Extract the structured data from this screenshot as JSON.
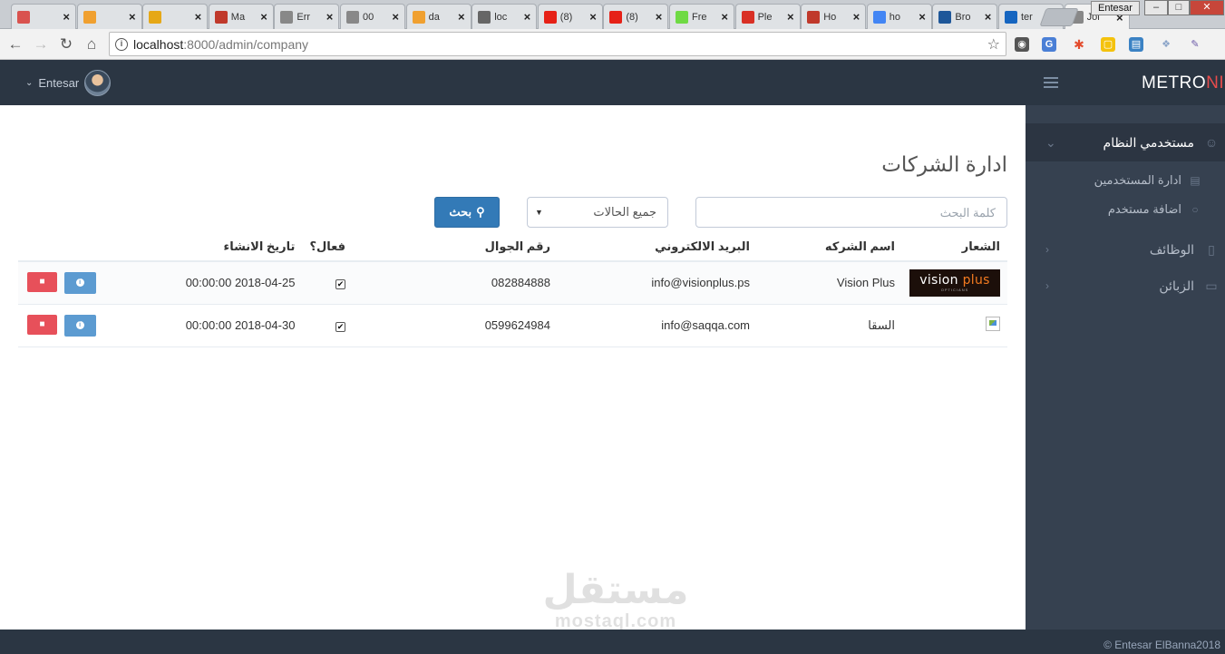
{
  "browser": {
    "tabs": [
      {
        "title": "",
        "favicon": "download-icon",
        "color": "#d9534f"
      },
      {
        "title": "",
        "favicon": "phpmyadmin-icon",
        "color": "#f0a030"
      },
      {
        "title": "",
        "favicon": "bulb-icon",
        "color": "#e6a817"
      },
      {
        "title": "Ma",
        "favicon": "redirect-icon",
        "color": "#c0392b"
      },
      {
        "title": "Err",
        "favicon": "page-icon",
        "color": "#888888"
      },
      {
        "title": "00",
        "favicon": "page-icon",
        "color": "#888888"
      },
      {
        "title": "da",
        "favicon": "phpmyadmin-icon",
        "color": "#f0a030"
      },
      {
        "title": "loc",
        "favicon": "bootstrap-icon",
        "color": "#666666"
      },
      {
        "title": "(8)",
        "favicon": "youtube-icon",
        "color": "#e62117"
      },
      {
        "title": "(8)",
        "favicon": "youtube-icon",
        "color": "#e62117"
      },
      {
        "title": "Fre",
        "favicon": "upwork-icon",
        "color": "#6fda44"
      },
      {
        "title": "Ple",
        "favicon": "gmail-icon",
        "color": "#d93025"
      },
      {
        "title": "Ho",
        "favicon": "hosting-icon",
        "color": "#c0392b"
      },
      {
        "title": "ho",
        "favicon": "google-icon",
        "color": "#4285f4"
      },
      {
        "title": "Bro",
        "favicon": "box-icon",
        "color": "#1e5799"
      },
      {
        "title": "ter",
        "favicon": "tm-icon",
        "color": "#1565c0"
      },
      {
        "title": "Jol",
        "favicon": "page-icon",
        "color": "#888888"
      }
    ],
    "profile_name": "Entesar",
    "url_host": "localhost",
    "url_rest": ":8000/admin/company"
  },
  "header": {
    "logo_main": "METRO",
    "logo_accent": "NIC",
    "user_name": "Entesar"
  },
  "sidebar": {
    "section_label": "مستخدمي النظام",
    "sub_items": [
      "ادارة المستخدمين",
      "اضافة مستخدم"
    ],
    "items": [
      "الوظائف",
      "الزبائن"
    ]
  },
  "page": {
    "title": "ادارة الشركات",
    "search_placeholder": "كلمة البحث",
    "status_selected": "جميع الحالات",
    "search_button": "بحث"
  },
  "table": {
    "headers": [
      "الشعار",
      "اسم الشركه",
      "البريد الالكتروني",
      "رقم الجوال",
      "فعال؟",
      "تاريخ الانشاء"
    ],
    "rows": [
      {
        "logo_top": "vision",
        "logo_accent": "plus",
        "logo_sub": "OPTICIANS",
        "name": "Vision Plus",
        "email": "info@visionplus.ps",
        "mobile": "082884888",
        "active": true,
        "created": "2018-04-25 00:00:00"
      },
      {
        "name": "السقا",
        "email": "info@saqqa.com",
        "mobile": "0599624984",
        "active": true,
        "created": "2018-04-30 00:00:00"
      }
    ]
  },
  "watermark": {
    "arabic": "مستقل",
    "latin": "mostaql.com"
  },
  "footer": {
    "text": "© Entesar ElBanna2018"
  }
}
